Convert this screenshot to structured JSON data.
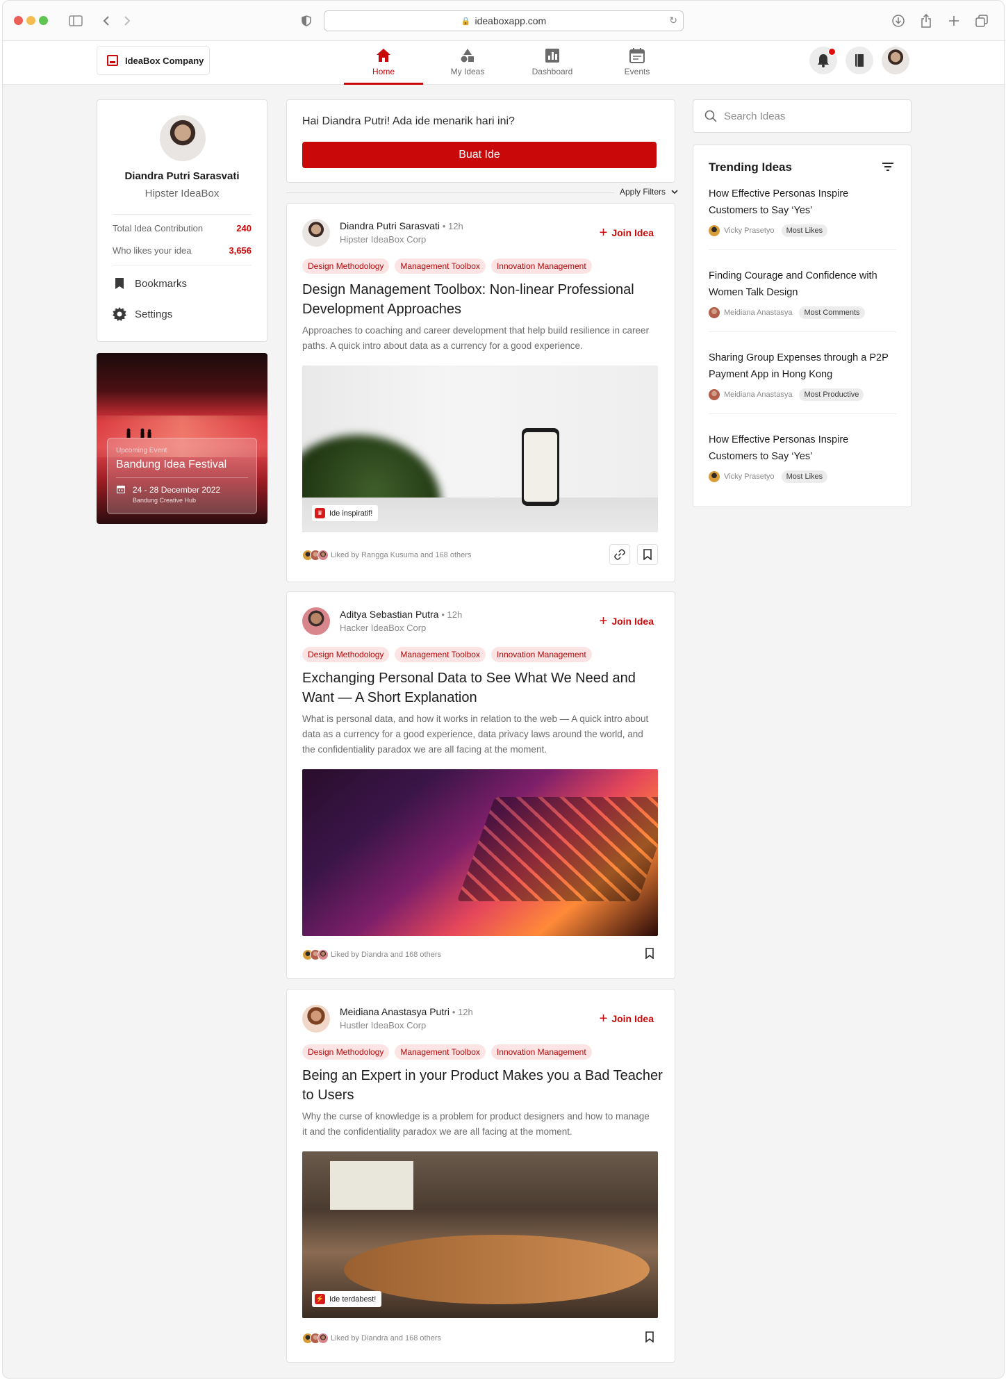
{
  "browser": {
    "url": "ideaboxapp.com"
  },
  "header": {
    "company": "IdeaBox Company",
    "nav": [
      {
        "label": "Home",
        "icon": "home-icon",
        "active": true
      },
      {
        "label": "My Ideas",
        "icon": "shapes-icon",
        "active": false
      },
      {
        "label": "Dashboard",
        "icon": "chart-icon",
        "active": false
      },
      {
        "label": "Events",
        "icon": "calendar-icon",
        "active": false
      }
    ],
    "accent": "#c90909"
  },
  "profile": {
    "name": "Diandra Putri Sarasvati",
    "role": "Hipster IdeaBox",
    "stats": [
      {
        "label": "Total Idea Contribution",
        "value": "240"
      },
      {
        "label": "Who likes your idea",
        "value": "3,656"
      }
    ],
    "menu": [
      {
        "label": "Bookmarks",
        "icon": "bookmark-icon"
      },
      {
        "label": "Settings",
        "icon": "gear-icon"
      }
    ]
  },
  "event": {
    "eyebrow": "Upcoming Event",
    "title": "Bandung Idea Festival",
    "date": "24 - 28 December 2022",
    "place": "Bandung Creative Hub"
  },
  "composer": {
    "greeting": "Hai Diandra Putri! Ada ide menarik hari ini?",
    "button": "Buat Ide"
  },
  "filters": {
    "label": "Apply Filters"
  },
  "posts": [
    {
      "author": "Diandra Putri Sarasvati",
      "time": "12h",
      "org": "Hipster IdeaBox Corp",
      "join": "Join Idea",
      "tags": [
        "Design Methodology",
        "Management Toolbox",
        "Innovation Management"
      ],
      "title": "Design Management Toolbox: Non-linear Professional Development Approaches",
      "body": "Approaches to coaching and career development that help build resilience in career paths. A quick intro about data as a currency for a good experience.",
      "badge": "Ide inspiratif!",
      "likes": "Liked by Rangga Kusuma and 168 others"
    },
    {
      "author": "Aditya Sebastian Putra",
      "time": "12h",
      "org": "Hacker IdeaBox Corp",
      "join": "Join Idea",
      "tags": [
        "Design Methodology",
        "Management Toolbox",
        "Innovation Management"
      ],
      "title": "Exchanging Personal Data to See What We Need and Want — A Short Explanation",
      "body": "What is personal data, and how it works in relation to the web — A quick intro about data as a currency for a good experience, data privacy laws around the world, and the confidentiality paradox we are all facing at the moment.",
      "likes": "Liked by Diandra and 168 others"
    },
    {
      "author": "Meidiana Anastasya Putri",
      "time": "12h",
      "org": "Hustler IdeaBox Corp",
      "join": "Join Idea",
      "tags": [
        "Design Methodology",
        "Management Toolbox",
        "Innovation Management"
      ],
      "title": "Being an Expert in your Product Makes you a Bad Teacher to Users",
      "body": "Why the curse of knowledge is a problem for product designers and how to manage it and the confidentiality paradox we are all facing at the moment.",
      "badge": "Ide terdabest!",
      "likes": "Liked by Diandra and 168 others"
    }
  ],
  "search": {
    "placeholder": "Search Ideas"
  },
  "trending": {
    "title": "Trending Ideas",
    "items": [
      {
        "title": "How Effective Personas Inspire Customers to Say ‘Yes’",
        "author": "Vicky Prasetyo",
        "chip": "Most Likes"
      },
      {
        "title": "Finding Courage and Confidence with Women Talk Design",
        "author": "Meidiana Anastasya",
        "chip": "Most Comments"
      },
      {
        "title": "Sharing Group Expenses through a P2P Payment App in Hong Kong",
        "author": "Meidiana Anastasya",
        "chip": "Most Productive"
      },
      {
        "title": "How Effective Personas Inspire Customers to Say ‘Yes’",
        "author": "Vicky Prasetyo",
        "chip": "Most Likes"
      }
    ]
  }
}
